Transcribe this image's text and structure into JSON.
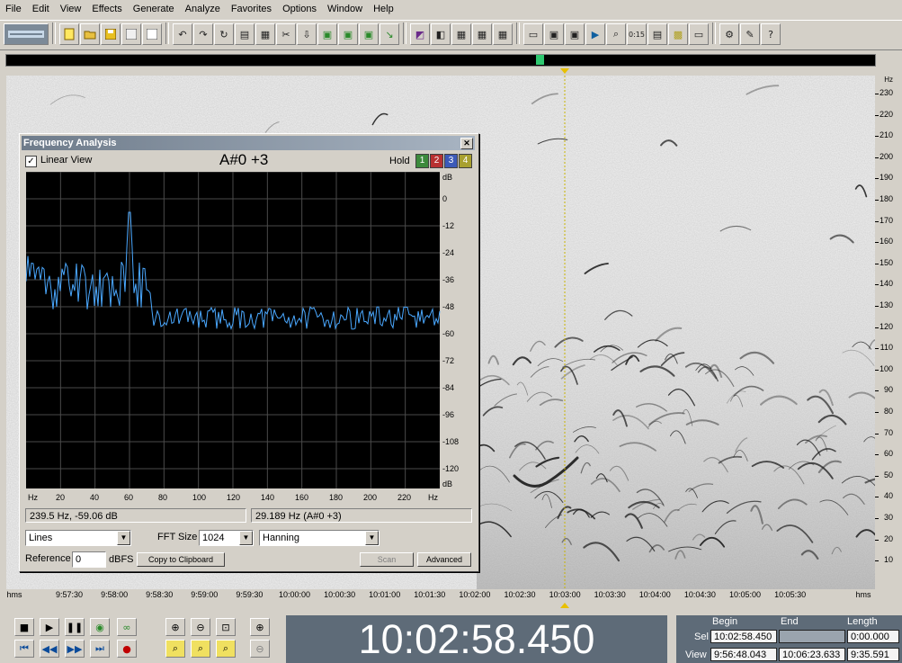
{
  "menu": [
    "File",
    "Edit",
    "View",
    "Effects",
    "Generate",
    "Analyze",
    "Favorites",
    "Options",
    "Window",
    "Help"
  ],
  "freq_analysis": {
    "title": "Frequency Analysis",
    "linear_view_label": "Linear View",
    "linear_view_checked": true,
    "note": "A#0 +3",
    "hold_label": "Hold",
    "hold_buttons": [
      "1",
      "2",
      "3",
      "4"
    ],
    "hold_colors": [
      "#3c8a3c",
      "#b83232",
      "#3c5ab8",
      "#a8a030"
    ],
    "db_unit": "dB",
    "db_ticks": [
      "0",
      "-12",
      "-24",
      "-36",
      "-48",
      "-60",
      "-72",
      "-84",
      "-96",
      "-108",
      "-120"
    ],
    "hz_ticks": [
      "Hz",
      "20",
      "40",
      "60",
      "80",
      "100",
      "120",
      "140",
      "160",
      "180",
      "200",
      "220",
      "Hz"
    ],
    "cursor_readout": "239.5 Hz, -59.06 dB",
    "peak_readout": "29.189 Hz (A#0 +3)",
    "graph_type": "Lines",
    "fft_size_label": "FFT Size",
    "fft_size": "1024",
    "window": "Hanning",
    "reference_label": "Reference",
    "reference_value": "0",
    "reference_unit": "dBFS",
    "copy_button": "Copy to Clipboard",
    "scan_button": "Scan",
    "advanced_button": "Advanced",
    "trace_color": "#4aa8ff"
  },
  "spectrogram": {
    "hz_axis_unit": "Hz",
    "hz_labels": [
      "230",
      "220",
      "210",
      "200",
      "190",
      "180",
      "170",
      "160",
      "150",
      "140",
      "130",
      "120",
      "110",
      "100",
      "90",
      "80",
      "70",
      "60",
      "50",
      "40",
      "30",
      "20",
      "10"
    ],
    "time_axis_unit": "hms",
    "time_labels": [
      "9:57:30",
      "9:58:00",
      "9:58:30",
      "9:59:00",
      "9:59:30",
      "10:00:00",
      "10:00:30",
      "10:01:00",
      "10:01:30",
      "10:02:00",
      "10:02:30",
      "10:03:00",
      "10:03:30",
      "10:04:00",
      "10:04:30",
      "10:05:00",
      "10:05:30"
    ]
  },
  "transport": {
    "time_display": "10:02:58.450",
    "begin_label": "Begin",
    "end_label": "End",
    "length_label": "Length",
    "sel_label": "Sel",
    "view_label": "View",
    "sel_begin": "10:02:58.450",
    "sel_end": "",
    "sel_length": "0:00.000",
    "view_begin": "9:56:48.043",
    "view_end": "10:06:23.633",
    "view_length": "9:35.591"
  },
  "icons": {
    "toolbar": [
      "waveform-toggle-icon",
      "new-file-icon",
      "open-file-icon",
      "save-icon",
      "save-as-icon",
      "close-file-icon",
      "undo-icon",
      "redo-icon",
      "repeat-icon",
      "copy-to-new-icon",
      "paste-icon",
      "cut-icon",
      "trim-icon",
      "mix-paste-icon",
      "export-icon",
      "effect-icon",
      "analysis-icon",
      "favorites-icon",
      "cue-icon",
      "marker-icon",
      "insert-icon",
      "batch-icon",
      "playlist-icon",
      "play-icon",
      "zoom-icon",
      "time-icon",
      "info-icon",
      "spectral-icon",
      "frequency-icon",
      "settings-icon",
      "script-icon",
      "help-icon"
    ]
  }
}
